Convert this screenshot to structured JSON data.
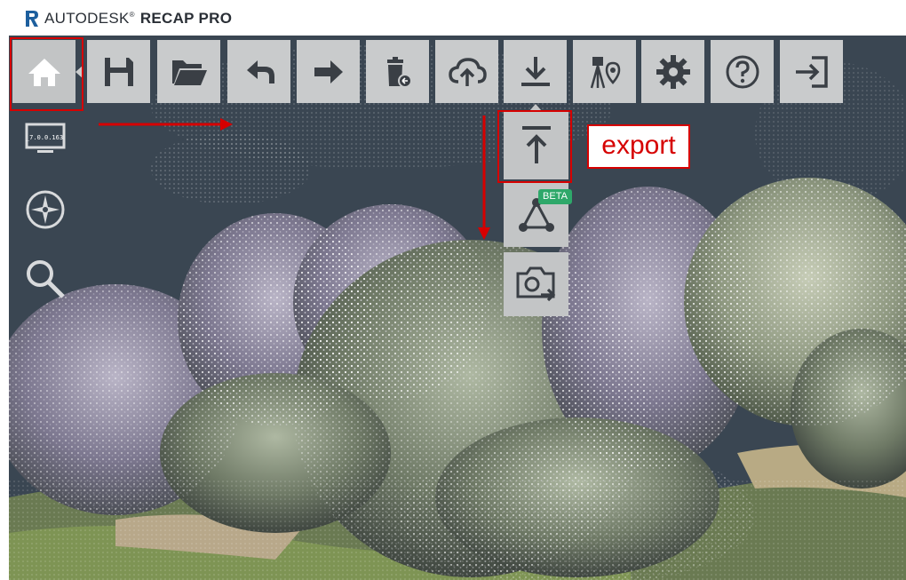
{
  "app": {
    "brand": "AUTODESK",
    "product": "RECAP PRO"
  },
  "toolbar": [
    {
      "name": "home-button",
      "icon": "home-icon"
    },
    {
      "name": "save-button",
      "icon": "save-icon"
    },
    {
      "name": "open-button",
      "icon": "folder-open-icon"
    },
    {
      "name": "undo-button",
      "icon": "undo-icon"
    },
    {
      "name": "redo-button",
      "icon": "redo-icon"
    },
    {
      "name": "delete-button",
      "icon": "trash-icon"
    },
    {
      "name": "upload-button",
      "icon": "cloud-upload-icon"
    },
    {
      "name": "download-button",
      "icon": "download-icon"
    },
    {
      "name": "geolocation-button",
      "icon": "survey-tripod-icon"
    },
    {
      "name": "settings-button",
      "icon": "gear-icon"
    },
    {
      "name": "help-button",
      "icon": "help-icon"
    },
    {
      "name": "exit-button",
      "icon": "exit-icon"
    }
  ],
  "sidebar": {
    "monitor_label": "_7.0.0.163"
  },
  "flyout": {
    "beta_label": "BETA"
  },
  "annotation": {
    "callout_text": "export",
    "color": "#d60000"
  },
  "colors": {
    "toolbar_bg": "#c9cbcc",
    "viewport_bg": "#3a4652",
    "beta_badge": "#2ea86a"
  }
}
